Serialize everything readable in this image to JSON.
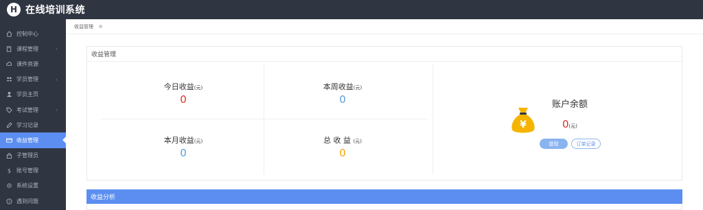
{
  "app": {
    "logo_letter": "H",
    "title": "在线培训系统"
  },
  "sidebar": {
    "items": [
      {
        "label": "控制中心",
        "icon": "home-icon",
        "arrow": false,
        "active": false
      },
      {
        "label": "课程管理",
        "icon": "book-icon",
        "arrow": true,
        "active": false
      },
      {
        "label": "课件资源",
        "icon": "cloud-icon",
        "arrow": false,
        "active": false
      },
      {
        "label": "学员管理",
        "icon": "users-icon",
        "arrow": true,
        "active": false
      },
      {
        "label": "学员主页",
        "icon": "user-icon",
        "arrow": false,
        "active": false
      },
      {
        "label": "考试管理",
        "icon": "tag-icon",
        "arrow": true,
        "active": false
      },
      {
        "label": "学习记录",
        "icon": "edit-icon",
        "arrow": false,
        "active": false
      },
      {
        "label": "收益管理",
        "icon": "card-icon",
        "arrow": false,
        "active": true
      },
      {
        "label": "子管理员",
        "icon": "lock-icon",
        "arrow": false,
        "active": false
      },
      {
        "label": "账号管理",
        "icon": "dollar-icon",
        "arrow": false,
        "active": false
      },
      {
        "label": "系统设置",
        "icon": "gear-icon",
        "arrow": false,
        "active": false
      },
      {
        "label": "遇到问题",
        "icon": "question-icon",
        "arrow": false,
        "active": false
      }
    ]
  },
  "breadcrumb": {
    "current": "收益管理"
  },
  "panel": {
    "title": "收益管理",
    "today": {
      "label": "今日收益",
      "unit": "(元)",
      "value": "0"
    },
    "week": {
      "label": "本周收益",
      "unit": "(元)",
      "value": "0"
    },
    "month": {
      "label": "本月收益",
      "unit": "(元)",
      "value": "0"
    },
    "total": {
      "label": "总 收 益",
      "unit": "(元)",
      "value": "0"
    },
    "balance": {
      "title": "账户余额",
      "value": "0",
      "unit": "(元)",
      "withdraw_label": "提现",
      "orders_label": "订单记录",
      "currency_symbol": "¥"
    }
  },
  "analysis": {
    "title": "收益分析"
  },
  "colors": {
    "sidebar_bg": "#2f3541",
    "accent": "#5b8ef0",
    "red": "#e0302c",
    "blue": "#5b9bd5",
    "orange": "#f0a500"
  }
}
